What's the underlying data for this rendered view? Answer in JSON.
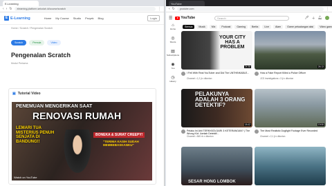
{
  "left_browser": {
    "tab_title": "E-Learning",
    "url": "elearning.platform-sekolah.id/course/scratch",
    "app": {
      "brand": "E-Learning",
      "nav": [
        "Home",
        "My Course",
        "Studio",
        "Proyek",
        "Blog"
      ],
      "login_label": "Login"
    },
    "breadcrumb": "Home / Scratch / Pengenalan Scratch",
    "badges": [
      "Scratch",
      "Pemula",
      "Video"
    ],
    "lesson_title": "Pengenalan Scratch",
    "lesson_meta": "Modul Pertama",
    "section_title": "Tutorial Video",
    "video": {
      "line1": "PENEMUAN MENGERIKAN SAAT",
      "line2": "RENOVASI RUMAH",
      "line3": "LEMARI TUA MISTERIUS PENUH SENJATA DI BANDUNG!!",
      "tag": "BONEKA & SURAT CREEPY!",
      "line5": "\"TERIMA KASIH SUDAH MEMBEBASKANKU\"",
      "watermark": "Watch on YouTube"
    }
  },
  "right_browser": {
    "tab_title": "YouTube",
    "url": "youtube.com",
    "brand": "YouTube",
    "search_placeholder": "Search",
    "chips": [
      "Semua",
      "Musik",
      "Mix",
      "Podcast",
      "Gaming",
      "Berita",
      "Live",
      "Alam",
      "Game petualangan aksi",
      "Video game"
    ],
    "sidebar": [
      {
        "icon": "⌂",
        "label": "Home"
      },
      {
        "icon": "◎",
        "label": "Shorts"
      },
      {
        "icon": "▤",
        "label": "Subscriptions"
      },
      {
        "icon": "◉",
        "label": "You"
      },
      {
        "icon": "◷",
        "label": "History"
      }
    ],
    "videos": [
      {
        "title": "I Fell With Real YouTuber and Did The UNTHINKABLE...",
        "meta": "Channel • 1,2 jt x ditonton",
        "duration": "24:38",
        "overlay": "YOUR CITY HAS A PROBLEM"
      },
      {
        "title": "How a Fake Report Killed a Police Officer",
        "meta": "JCS Investigations • 3 jt x ditonton",
        "duration": "26:13",
        "overlay": ""
      },
      {
        "title": "Pelaku Ini Ahli TERNYATA DARI 3 KETERANGAN? | The Wrong Kid: Jumlah Detektif...",
        "meta": "Channel • 845 rb x ditonton",
        "duration": "18:42",
        "overlay": "PELAKUNYA ADALAH 3 ORANG DETEKTIF?"
      },
      {
        "title": "The Most Realistic Dogfight Footage Ever Recorded",
        "meta": "Channel • 2,1 jt x ditonton",
        "duration": "19:06",
        "overlay": ""
      },
      {
        "title": "Sesar Hong Lombok",
        "meta": "",
        "duration": "",
        "overlay": "SESAR HONG LOMBOK"
      },
      {
        "title": "Ocean footage",
        "meta": "",
        "duration": "",
        "overlay": ""
      }
    ]
  }
}
